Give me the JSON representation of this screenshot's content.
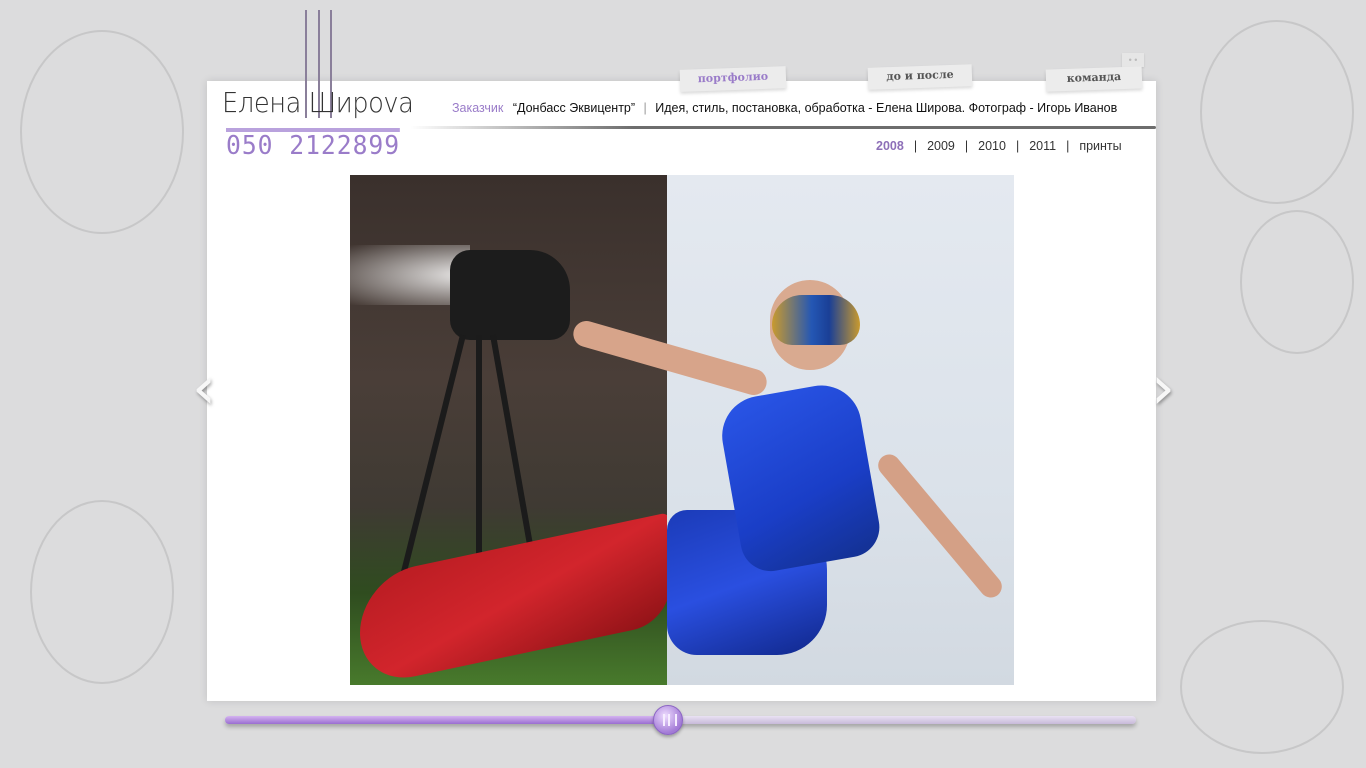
{
  "logo": {
    "name": "Елена Ширova",
    "phone": "050 2122899"
  },
  "nav": {
    "tabs": [
      {
        "label": "портфолио",
        "color": "#9a7cc9"
      },
      {
        "label": "до и после",
        "color": "#555555"
      },
      {
        "label": "команда",
        "color": "#555555"
      }
    ]
  },
  "credits": {
    "label": "Заказчик",
    "client": "“Донбасс Эквицентр”",
    "separator": "|",
    "text": "Идея, стиль, постановка, обработка - Елена Широва. Фотограф - Игорь Иванов"
  },
  "years": {
    "items": [
      {
        "label": "2008",
        "active": true
      },
      {
        "label": "2009",
        "active": false
      },
      {
        "label": "2010",
        "active": false
      },
      {
        "label": "2011",
        "active": false
      },
      {
        "label": "принты",
        "active": false
      }
    ]
  },
  "gallery": {
    "prev_icon": "chevron-left-icon",
    "next_icon": "chevron-right-icon",
    "prev_glyph": "‹",
    "next_glyph": "›"
  },
  "slider": {
    "value_fraction": 0.485,
    "accent": "#9a6ed1"
  },
  "corner": {
    "glyph": "• •"
  },
  "colors": {
    "accent": "#9a7cc9",
    "background": "#dcdcdd"
  }
}
